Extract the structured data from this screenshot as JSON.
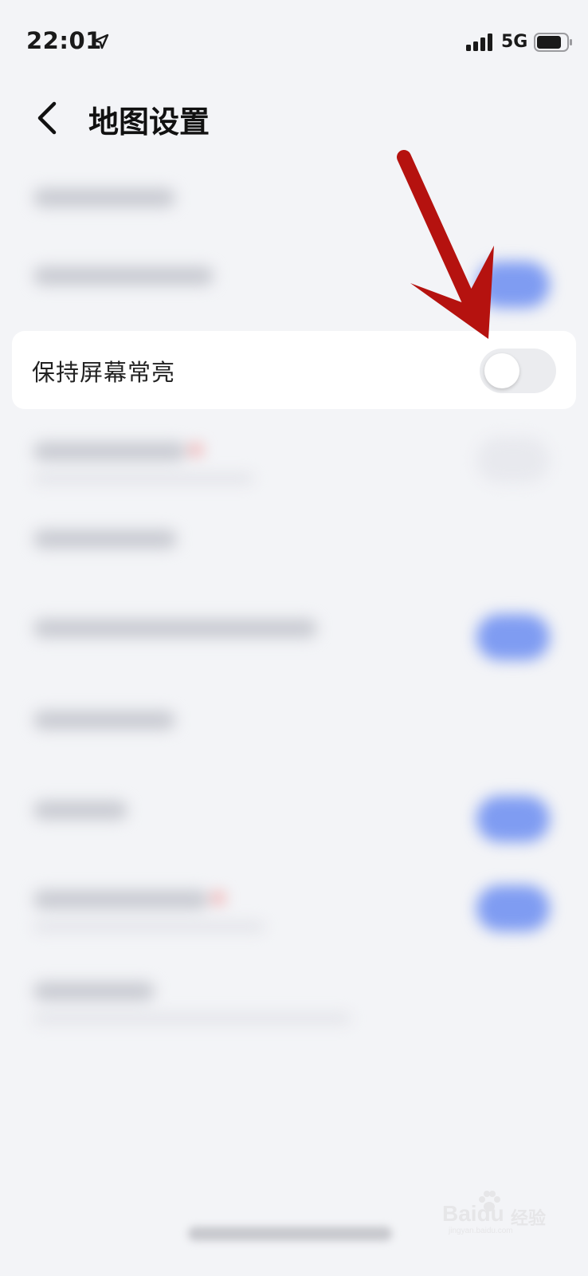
{
  "status_bar": {
    "time": "22:01",
    "network": "5G",
    "icons": [
      "location-arrow-icon",
      "signal-bars-icon",
      "battery-icon"
    ]
  },
  "header": {
    "title": "地图设置",
    "back_icon": "chevron-left-icon"
  },
  "settings": {
    "keep_screen_on": {
      "label": "保持屏幕常亮",
      "toggle_state": "off"
    }
  },
  "annotation": {
    "arrow_color": "#b5120f"
  },
  "watermark": {
    "brand": "Baidu",
    "cn": "经验",
    "url": "jingyan.baidu.com"
  },
  "colors": {
    "background": "#f3f4f7",
    "toggle_on_blur": "#7f9cf2",
    "toggle_off": "#ebecef"
  }
}
